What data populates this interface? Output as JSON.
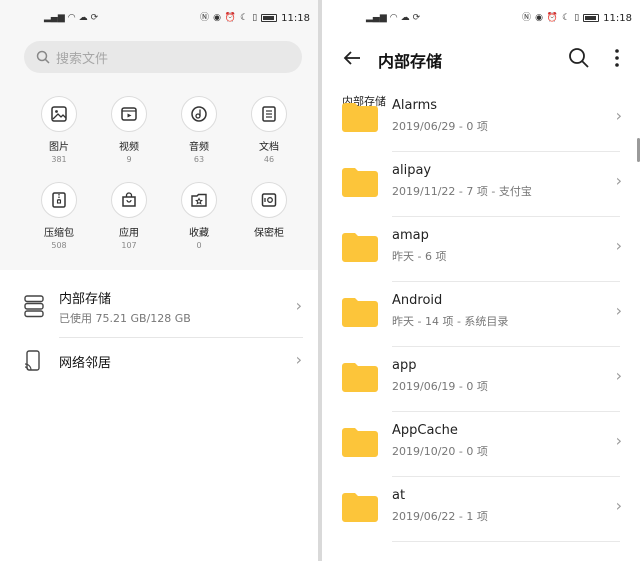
{
  "status": {
    "left_icons": [
      "signal-icon",
      "wifi-icon",
      "cloud-icon",
      "sync-icon"
    ],
    "left_text": "⁴ᴳ .ıı",
    "right_icons": [
      "nfc-icon",
      "eye-icon",
      "alarm-icon",
      "moon-icon",
      "vibrate-icon",
      "battery-icon"
    ],
    "time": "11:18"
  },
  "left": {
    "search_placeholder": "搜索文件",
    "categories": [
      {
        "label": "图片",
        "count": "381",
        "icon": "image-icon"
      },
      {
        "label": "视频",
        "count": "9",
        "icon": "video-icon"
      },
      {
        "label": "音频",
        "count": "63",
        "icon": "audio-icon"
      },
      {
        "label": "文档",
        "count": "46",
        "icon": "document-icon"
      },
      {
        "label": "压缩包",
        "count": "508",
        "icon": "archive-icon"
      },
      {
        "label": "应用",
        "count": "107",
        "icon": "app-icon"
      },
      {
        "label": "收藏",
        "count": "0",
        "icon": "favorite-icon"
      },
      {
        "label": "保密柜",
        "count": "",
        "icon": "safe-icon"
      }
    ],
    "storage": {
      "title": "内部存储",
      "usage": "已使用 75.21 GB/128 GB"
    },
    "network": {
      "title": "网络邻居"
    }
  },
  "right": {
    "title": "内部存储",
    "breadcrumb": "内部存储",
    "items": [
      {
        "name": "Alarms",
        "meta": "2019/06/29 - 0 项"
      },
      {
        "name": "alipay",
        "meta": "2019/11/22 - 7 项 - 支付宝"
      },
      {
        "name": "amap",
        "meta": "昨天 - 6 项"
      },
      {
        "name": "Android",
        "meta": "昨天 - 14 项 - 系统目录"
      },
      {
        "name": "app",
        "meta": "2019/06/19 - 0 项"
      },
      {
        "name": "AppCache",
        "meta": "2019/10/20 - 0 项"
      },
      {
        "name": "at",
        "meta": "2019/06/22 - 1 项"
      }
    ]
  },
  "colors": {
    "folder": "#fcc53a",
    "accent_gray": "#9a9a9a"
  }
}
